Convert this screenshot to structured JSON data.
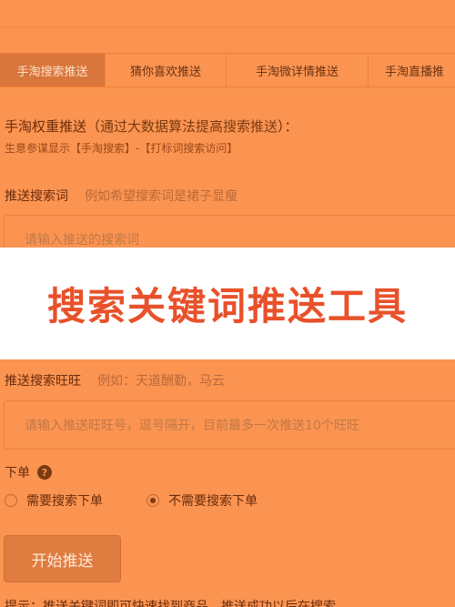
{
  "tabs": [
    {
      "label": "手淘搜索推送",
      "active": true
    },
    {
      "label": "猜你喜欢推送",
      "active": false
    },
    {
      "label": "手淘微详情推送",
      "active": false
    },
    {
      "label": "手淘直播推",
      "active": false
    }
  ],
  "weight": {
    "title": "手淘权重推送（",
    "note": "通过大数据算法提高搜索推送",
    "title_end": "）：",
    "sub": "生意参谋显示【手淘搜索】-【打标词搜索访问】"
  },
  "keyword": {
    "label": "推送搜索词",
    "hint": "例如希望搜索词是裙子显瘦",
    "placeholder": "请输入推送的搜索词"
  },
  "banner": {
    "title": "搜索关键词推送工具",
    "color": "#e8512a"
  },
  "wangwang": {
    "label": "推送搜索旺旺",
    "hint": "例如：天道酬勤，马云",
    "placeholder": "请输入推送旺旺号，逗号隔开，目前最多一次推送10个旺旺"
  },
  "order": {
    "label": "下单",
    "help_icon": "question-circle-icon",
    "options": [
      {
        "label": "需要搜索下单",
        "checked": false
      },
      {
        "label": "不需要搜索下单",
        "checked": true
      }
    ]
  },
  "start_button": "开始推送",
  "bottom_tip": "提示：推送关键词即可快速找到商品，推送成功以后在搜索",
  "colors": {
    "overlay": "#fb9451",
    "active_tab": "#d9763b",
    "button": "#df7c40"
  }
}
